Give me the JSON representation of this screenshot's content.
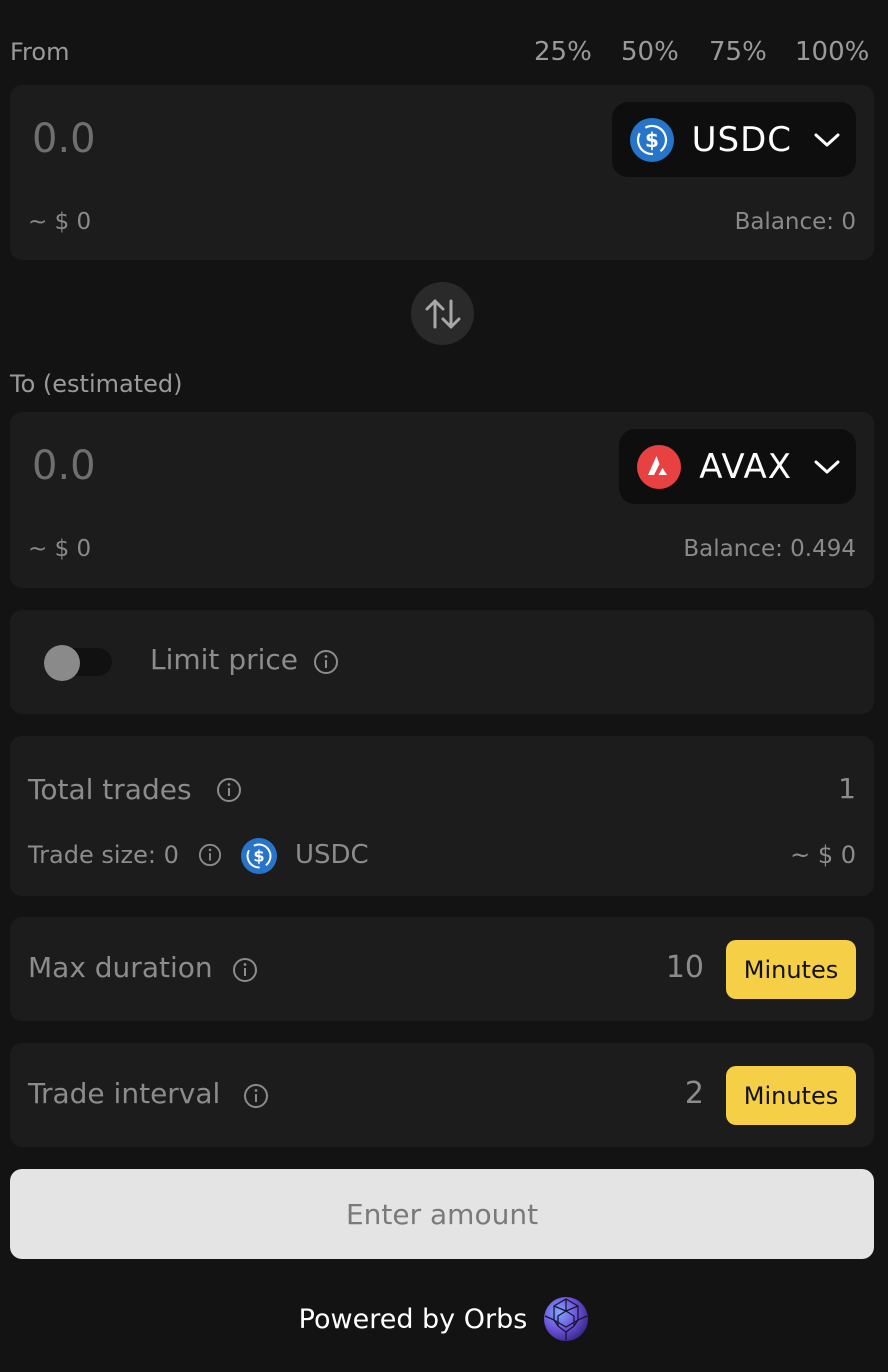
{
  "from": {
    "label": "From",
    "percentages": [
      "25%",
      "50%",
      "75%",
      "100%"
    ],
    "amount_placeholder": "0.0",
    "usd": "~ $ 0",
    "balance": "Balance: 0",
    "token": "USDC"
  },
  "to": {
    "label": "To (estimated)",
    "amount_placeholder": "0.0",
    "usd": "~ $ 0",
    "balance": "Balance: 0.494",
    "token": "AVAX"
  },
  "limit": {
    "label": "Limit price",
    "enabled": false
  },
  "trades": {
    "total_label": "Total trades",
    "total_value": "1",
    "size_label": "Trade size: 0",
    "size_token": "USDC",
    "size_usd": "~ $ 0"
  },
  "max_duration": {
    "label": "Max duration",
    "value": "10",
    "unit": "Minutes"
  },
  "trade_interval": {
    "label": "Trade interval",
    "value": "2",
    "unit": "Minutes"
  },
  "submit_label": "Enter amount",
  "footer": "Powered by Orbs",
  "colors": {
    "background": "#131313",
    "card": "#1c1c1c",
    "accent_yellow": "#f5cf45",
    "usdc_blue": "#2775ca",
    "avax_red": "#e84142"
  }
}
